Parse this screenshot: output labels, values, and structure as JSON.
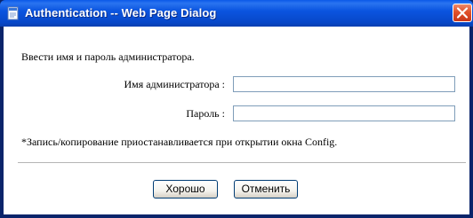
{
  "window": {
    "title": "Authentication -- Web Page Dialog",
    "icon": "ie-page-icon",
    "close_icon": "close-x-icon"
  },
  "form": {
    "intro_text": "Ввести имя и пароль администратора.",
    "admin_label": "Имя администратора :",
    "admin_value": "",
    "password_label": "Пароль :",
    "password_value": "",
    "note_text": "*Запись/копирование приостанавливается при открытии окна Config."
  },
  "buttons": {
    "ok_label": "Хорошо",
    "cancel_label": "Отменить"
  },
  "colors": {
    "titlebar": "#0a55e0",
    "close_button": "#e0502a",
    "field_border": "#7f9db9",
    "button_border": "#003c74"
  }
}
